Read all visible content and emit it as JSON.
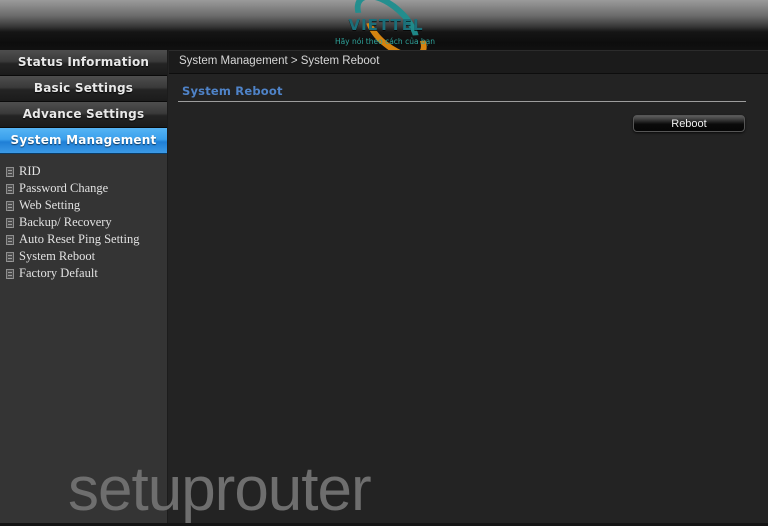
{
  "header": {
    "logo_text": "VIETTEL",
    "logo_tagline": "Hãy nói theo cách của bạn",
    "teal_color": "#1f8f8f",
    "orange_color": "#e08a10"
  },
  "sidebar": {
    "nav": [
      {
        "label": "Status Information",
        "selected": false
      },
      {
        "label": "Basic Settings",
        "selected": false
      },
      {
        "label": "Advance Settings",
        "selected": false
      },
      {
        "label": "System Management",
        "selected": true
      }
    ],
    "submenu": [
      {
        "label": "RID",
        "icon": "document-icon"
      },
      {
        "label": "Password Change",
        "icon": "document-icon"
      },
      {
        "label": "Web Setting",
        "icon": "document-icon"
      },
      {
        "label": "Backup/ Recovery",
        "icon": "document-icon"
      },
      {
        "label": "Auto Reset Ping Setting",
        "icon": "document-icon"
      },
      {
        "label": "System Reboot",
        "icon": "document-icon"
      },
      {
        "label": "Factory Default",
        "icon": "document-icon"
      }
    ]
  },
  "content": {
    "breadcrumb": "System Management > System Reboot",
    "section_title": "System Reboot",
    "section_title_color": "#4f83c8",
    "reboot_button_label": "Reboot"
  },
  "watermark": {
    "text": "setuprouter"
  }
}
